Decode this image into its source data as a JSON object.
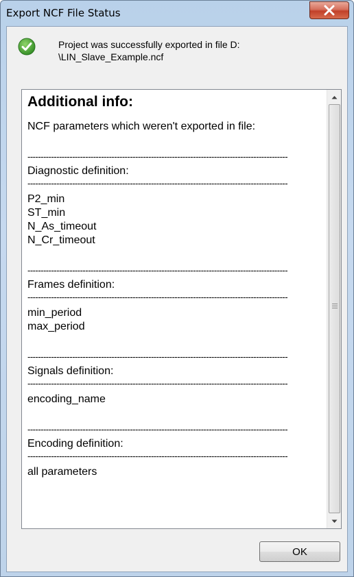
{
  "window": {
    "title": "Export NCF File Status"
  },
  "status": {
    "icon": "check-circle-icon",
    "message_line1": "Project was successfully exported in file D:",
    "message_line2": "\\LIN_Slave_Example.ncf"
  },
  "info": {
    "heading": "Additional info:",
    "intro": "NCF parameters which weren't exported in file:",
    "separator": "---------------------------------------------------------------------------------------------------",
    "sections": [
      {
        "title": "Diagnostic definition:",
        "params": [
          "P2_min",
          "ST_min",
          "N_As_timeout",
          "N_Cr_timeout"
        ]
      },
      {
        "title": "Frames definition:",
        "params": [
          "min_period",
          "max_period"
        ]
      },
      {
        "title": "Signals definition:",
        "params": [
          "encoding_name"
        ]
      },
      {
        "title": "Encoding definition:",
        "params": [
          "all parameters"
        ]
      }
    ]
  },
  "buttons": {
    "ok": "OK",
    "close_icon": "close-icon"
  },
  "colors": {
    "close_button": "#c2402a",
    "check_icon": "#3c9a2e"
  }
}
